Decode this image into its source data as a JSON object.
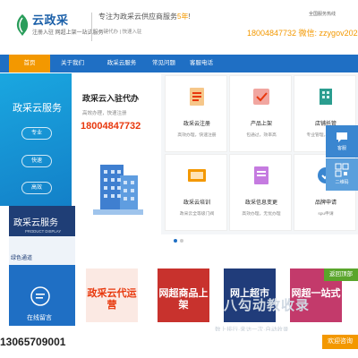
{
  "header": {
    "logo_title": "云政采",
    "logo_sub": "注册入驻 网超上架一站式服务",
    "slogan_prefix": "专注为政采云供应商服务",
    "slogan_years": "5年",
    "slogan_suffix": "!",
    "slogan2": "一键代办 | 快速入驻",
    "hotline_label": "全国服务热线",
    "hotline": "18004847732 微信: zzygov2020"
  },
  "nav": {
    "items": [
      "首页",
      "关于我们",
      "政采云服务",
      "常见问题",
      "客服电话"
    ]
  },
  "hero": {
    "title": "政采云服务",
    "pills": [
      "专业",
      "快速",
      "高效"
    ]
  },
  "promo": {
    "title": "政采云入驻代办",
    "sub": "高效办理，快速注册",
    "phone": "18004847732"
  },
  "cards": [
    {
      "title": "政采云注册",
      "sub": "高效办理，快速注册",
      "icon": "register-icon"
    },
    {
      "title": "产品上架",
      "sub": "包通过，效率高",
      "icon": "product-icon"
    },
    {
      "title": "店铺托管",
      "sub": "专业管理，稳定运营",
      "icon": "store-icon"
    },
    {
      "title": "政采云培训",
      "sub": "政采云全等级门阀",
      "icon": "training-icon"
    },
    {
      "title": "政采信息变更",
      "sub": "高效办理，无忧办理",
      "icon": "change-icon"
    },
    {
      "title": "品牌申请",
      "sub": "spu申请",
      "icon": "brand-icon"
    }
  ],
  "float": {
    "wechat": "客服",
    "qrcode": "二维码"
  },
  "product_display": {
    "title": "政采云服务",
    "sub": "PRODUCT DISPLAY",
    "nav_item": "绿色通道",
    "msg_label": "在线留言"
  },
  "products": [
    {
      "title": "政采云代运营",
      "color": "#e8380d",
      "bg": "#fbe9e3"
    },
    {
      "title": "网超商品上架",
      "color": "#fff",
      "bg": "#c8322d"
    },
    {
      "title": "网上超市",
      "color": "#fff",
      "bg": "#203c7a"
    },
    {
      "title": "网超一站式",
      "color": "#fff",
      "bg": "#c33a6b"
    }
  ],
  "footer": {
    "phone": "13065709001",
    "watermark": "八勾动教收录",
    "watermark_sub": "数上排行·来访一次·自动收录",
    "back_top": "返回顶部",
    "welcome": "欢迎咨询"
  },
  "colors": {
    "primary": "#1f6fc4",
    "accent": "#f39800",
    "phone_red": "#e8380d"
  }
}
